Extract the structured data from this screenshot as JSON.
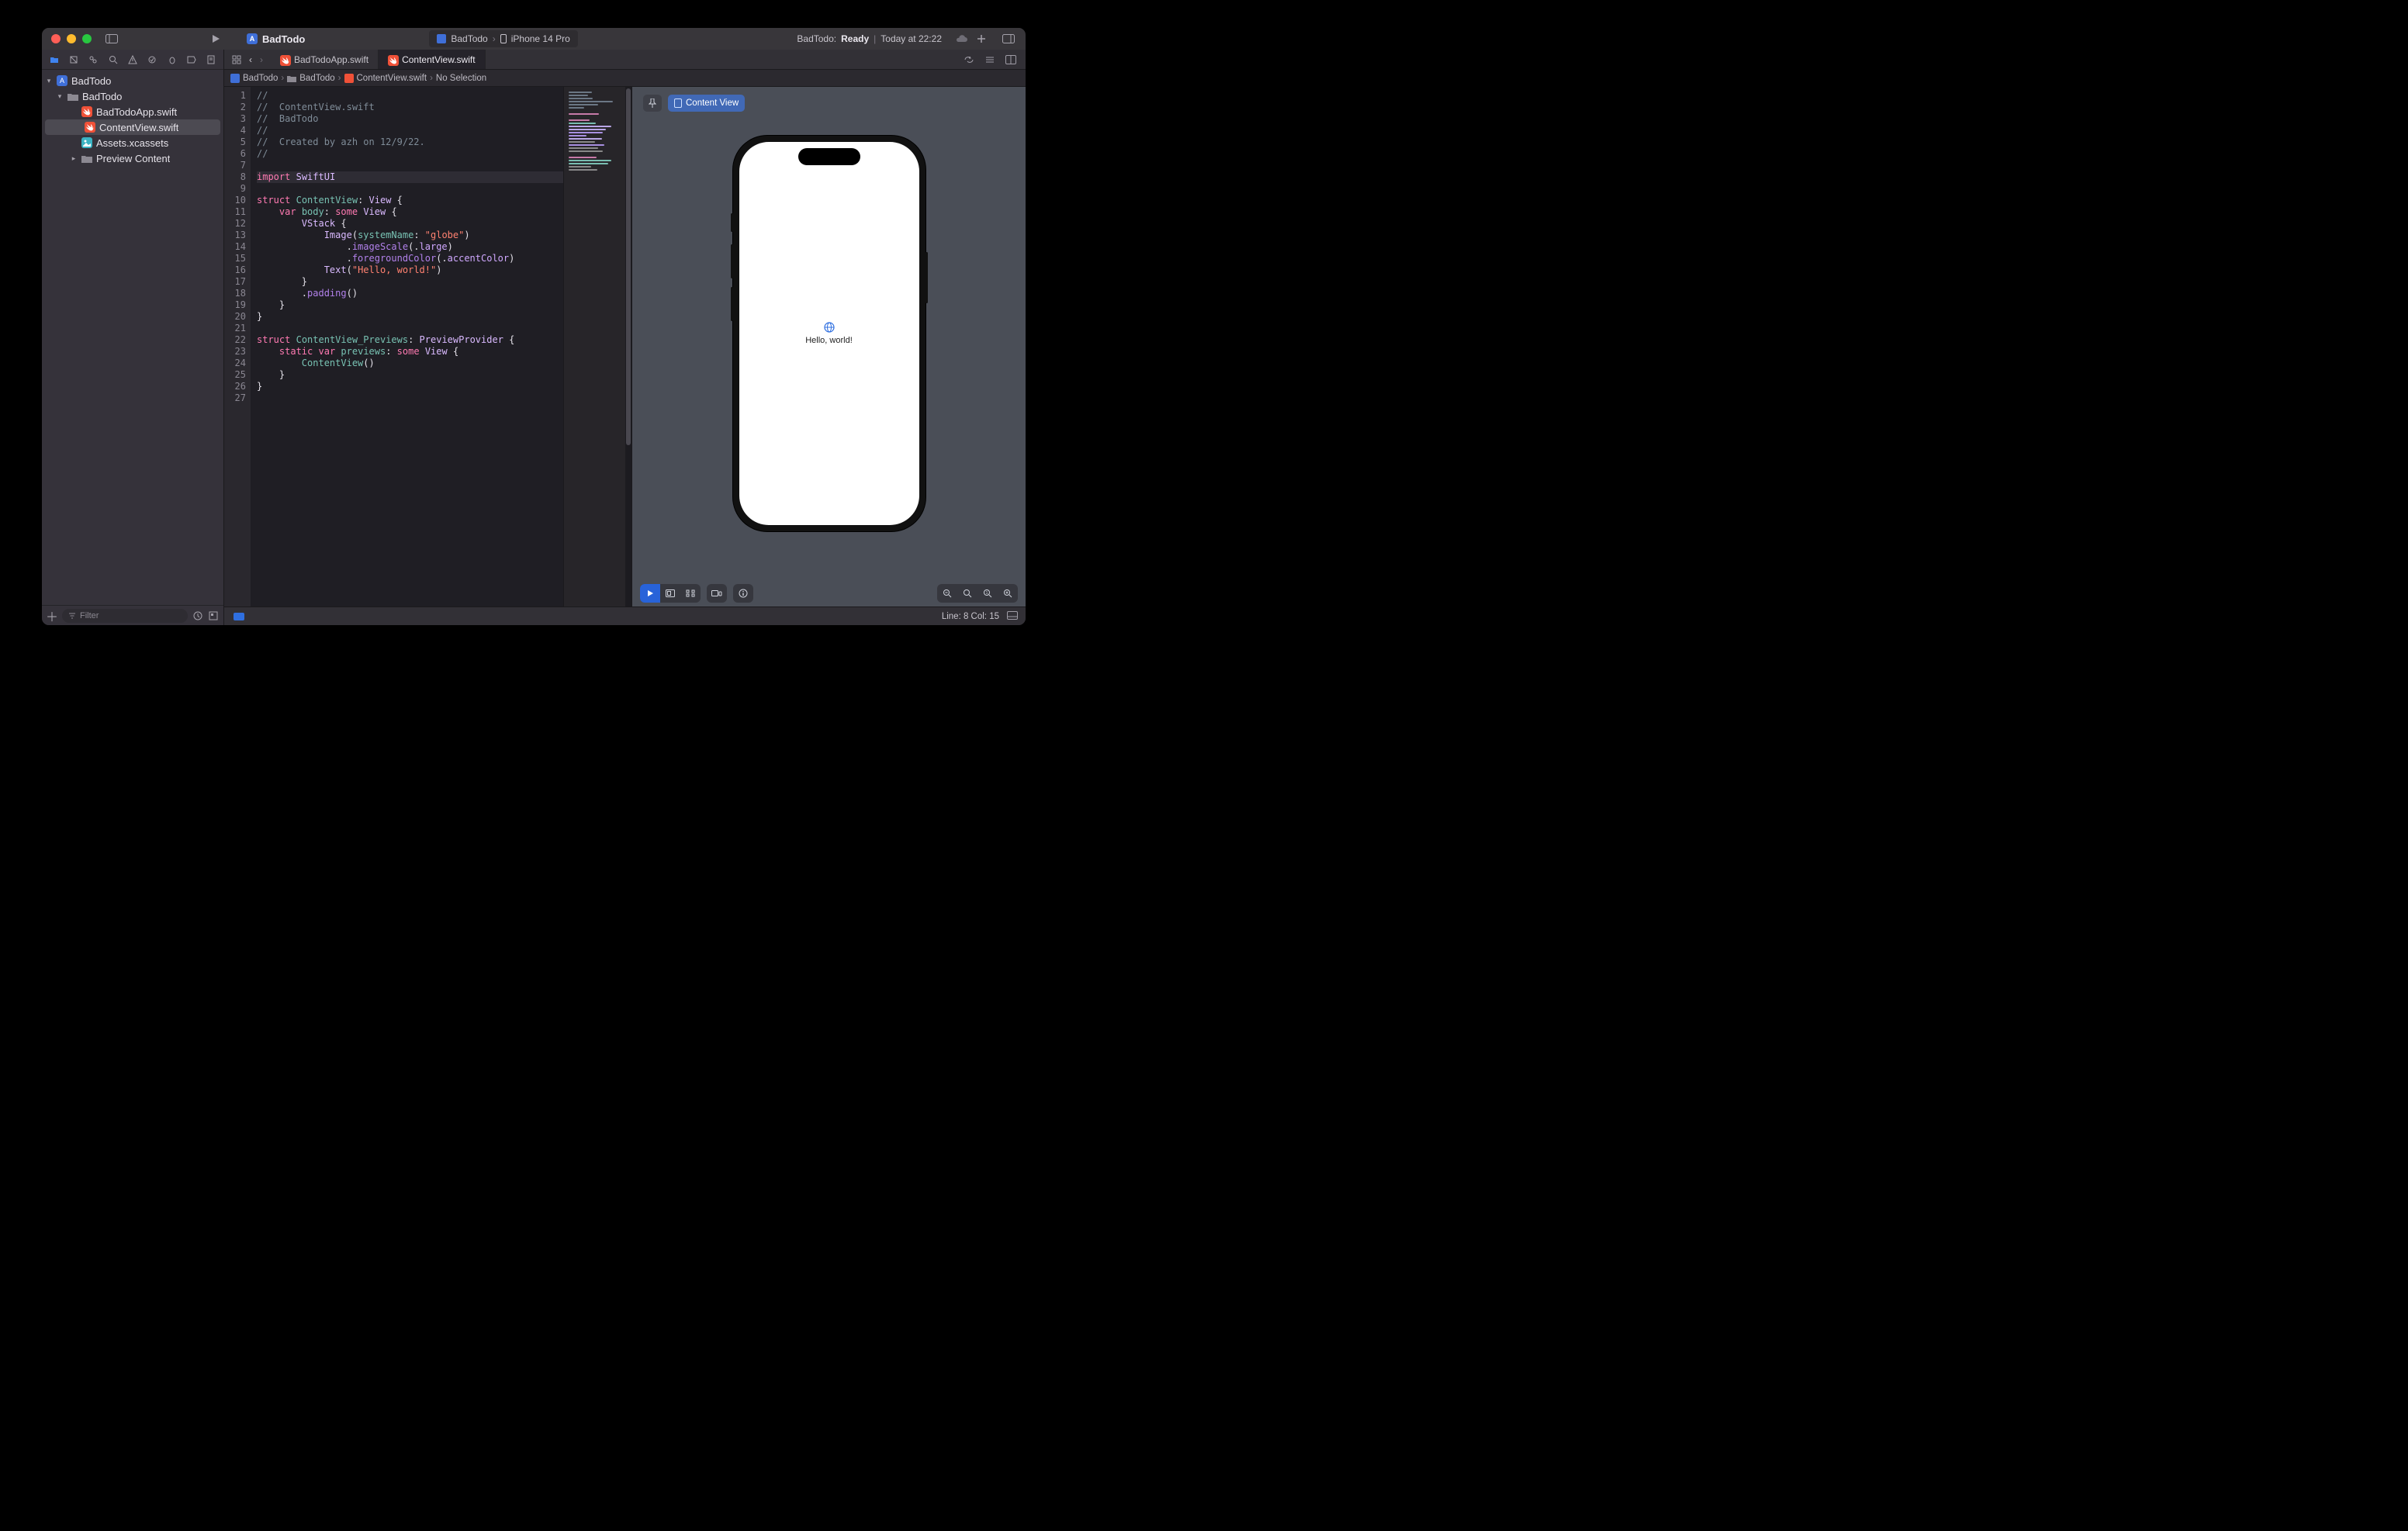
{
  "titlebar": {
    "project_name": "BadTodo",
    "scheme": {
      "target": "BadTodo",
      "device": "iPhone 14 Pro"
    },
    "status_prefix": "BadTodo: ",
    "status_ready": "Ready",
    "status_time": "Today at 22:22"
  },
  "navigator": {
    "items": [
      {
        "label": "BadTodo",
        "icon": "xcode-proj",
        "depth": 0,
        "disclosure": "open"
      },
      {
        "label": "BadTodo",
        "icon": "folder",
        "depth": 1,
        "disclosure": "open"
      },
      {
        "label": "BadTodoApp.swift",
        "icon": "swift",
        "depth": 2,
        "disclosure": ""
      },
      {
        "label": "ContentView.swift",
        "icon": "swift",
        "depth": 2,
        "disclosure": "",
        "selected": true
      },
      {
        "label": "Assets.xcassets",
        "icon": "assets",
        "depth": 2,
        "disclosure": ""
      },
      {
        "label": "Preview Content",
        "icon": "folder",
        "depth": 2,
        "disclosure": "closed"
      }
    ],
    "filter_placeholder": "Filter"
  },
  "tabs": [
    {
      "label": "BadTodoApp.swift",
      "active": false
    },
    {
      "label": "ContentView.swift",
      "active": true
    }
  ],
  "jump_bar": {
    "project": "BadTodo",
    "group": "BadTodo",
    "file": "ContentView.swift",
    "selection": "No Selection"
  },
  "code": {
    "lines": [
      "//",
      "//  ContentView.swift",
      "//  BadTodo",
      "//",
      "//  Created by azh on 12/9/22.",
      "//",
      "",
      "import SwiftUI",
      "",
      "struct ContentView: View {",
      "    var body: some View {",
      "        VStack {",
      "            Image(systemName: \"globe\")",
      "                .imageScale(.large)",
      "                .foregroundColor(.accentColor)",
      "            Text(\"Hello, world!\")",
      "        }",
      "        .padding()",
      "    }",
      "}",
      "",
      "struct ContentView_Previews: PreviewProvider {",
      "    static var previews: some View {",
      "        ContentView()",
      "    }",
      "}",
      ""
    ],
    "highlighted_line": 8
  },
  "preview": {
    "badge_label": "Content View",
    "hello_text": "Hello, world!"
  },
  "statusbar": {
    "line_col": "Line: 8  Col: 15"
  }
}
